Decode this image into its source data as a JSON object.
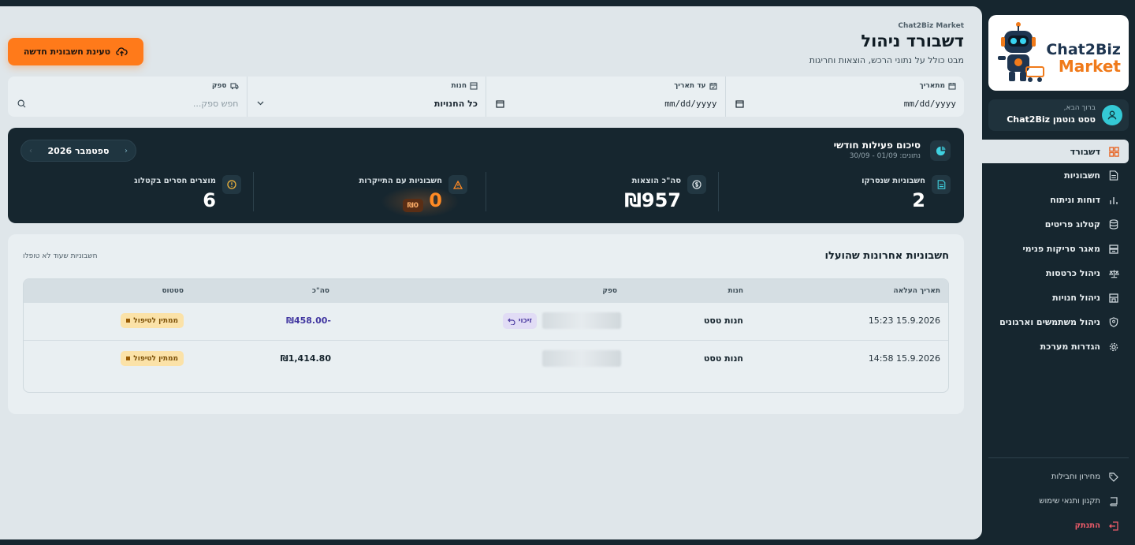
{
  "brand": {
    "logo_line1": "Chat2Biz",
    "logo_line2": "Market",
    "brand_small": "Chat2Biz Market"
  },
  "user": {
    "greeting": "ברוך הבא,",
    "name": "טסט גוטמן Chat2Biz"
  },
  "nav": {
    "items": [
      {
        "label": "דשבורד",
        "icon": "dashboard-icon",
        "active": true
      },
      {
        "label": "חשבוניות",
        "icon": "document-icon"
      },
      {
        "label": "דוחות וניתוח",
        "icon": "bar-chart-icon"
      },
      {
        "label": "קטלוג פריטים",
        "icon": "database-icon"
      },
      {
        "label": "מאגר סריקות פנימי",
        "icon": "archive-icon"
      },
      {
        "label": "ניהול כרטסות",
        "icon": "scale-icon"
      },
      {
        "label": "ניהול חנויות",
        "icon": "store-icon"
      },
      {
        "label": "ניהול משתמשים וארגונים",
        "icon": "shield-user-icon"
      },
      {
        "label": "הגדרות מערכת",
        "icon": "gear-icon"
      }
    ],
    "bottom": [
      {
        "label": "מחירון וחבילות",
        "icon": "tag-icon"
      },
      {
        "label": "תקנון ותנאי שימוש",
        "icon": "book-icon"
      },
      {
        "label": "התנתק",
        "icon": "logout-icon"
      }
    ]
  },
  "header": {
    "title": "דשבורד ניהול",
    "subtitle": "מבט כולל על נתוני הרכש, הוצאות וחריגות",
    "upload_button": "טעינת חשבונית חדשה"
  },
  "filters": {
    "from_label": "מתאריך",
    "from_value": "mm/dd/yyyy",
    "to_label": "עד תאריך",
    "to_value": "mm/dd/yyyy",
    "store_label": "חנות",
    "store_value": "כל החנויות",
    "supplier_label": "ספק",
    "supplier_placeholder": "חפש ספק..."
  },
  "summary": {
    "title": "סיכום פעילות חודשי",
    "range": "נתונים: 01/09 - 30/09",
    "month": "ספטמבר 2026",
    "stats": [
      {
        "label": "חשבוניות שנסרקו",
        "value": "2",
        "icon": "document-icon"
      },
      {
        "label": "סה\"כ הוצאות",
        "value": "₪957",
        "icon": "dollar-circle-icon"
      },
      {
        "label": "חשבוניות עם התייקרות",
        "value": "0",
        "badge": "₪0",
        "icon": "warning-icon"
      },
      {
        "label": "מוצרים חסרים בקטלוג",
        "value": "6",
        "icon": "alert-circle-icon"
      }
    ]
  },
  "recent": {
    "title": "חשבוניות אחרונות שהועלו",
    "link": "חשבוניות שעוד לא טופלו",
    "columns": {
      "date": "תאריך העלאה",
      "store": "חנות",
      "supplier": "ספק",
      "total": "סה\"כ",
      "status": "סטטוס"
    },
    "rows": [
      {
        "date": "15.9.2026 15:23",
        "store": "חנות טסט",
        "credit": "זיכוי",
        "total": "-₪458.00",
        "status": "ממתין לטיפול"
      },
      {
        "date": "15.9.2026 14:58",
        "store": "חנות טסט",
        "total": "₪1,414.80",
        "status": "ממתין לטיפול"
      }
    ]
  },
  "colors": {
    "accent": "#ff7a1a",
    "sidebar": "#16262f",
    "content_bg": "#dfe6ea",
    "negative_total": "#4136a0",
    "status_pending": "#fbe2a8"
  }
}
